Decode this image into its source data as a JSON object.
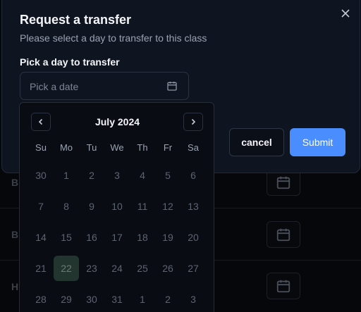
{
  "background_rows": [
    {
      "label": "B"
    },
    {
      "label": "B"
    },
    {
      "label": "H"
    }
  ],
  "dialog": {
    "title": "Request a transfer",
    "subtitle": "Please select a day to transfer to this class",
    "field_label": "Pick a day to transfer",
    "date_placeholder": "Pick a date",
    "cancel_label": "cancel",
    "submit_label": "Submit"
  },
  "calendar": {
    "month_label": "July 2024",
    "weekdays": [
      "Su",
      "Mo",
      "Tu",
      "We",
      "Th",
      "Fr",
      "Sa"
    ],
    "days": [
      "30",
      "1",
      "2",
      "3",
      "4",
      "5",
      "6",
      "7",
      "8",
      "9",
      "10",
      "11",
      "12",
      "13",
      "14",
      "15",
      "16",
      "17",
      "18",
      "19",
      "20",
      "21",
      "22",
      "23",
      "24",
      "25",
      "26",
      "27",
      "28",
      "29",
      "30",
      "31",
      "1",
      "2",
      "3"
    ],
    "selected_day": "22"
  },
  "colors": {
    "accent": "#4a8dff",
    "selected_day_bg": "#22352f"
  }
}
